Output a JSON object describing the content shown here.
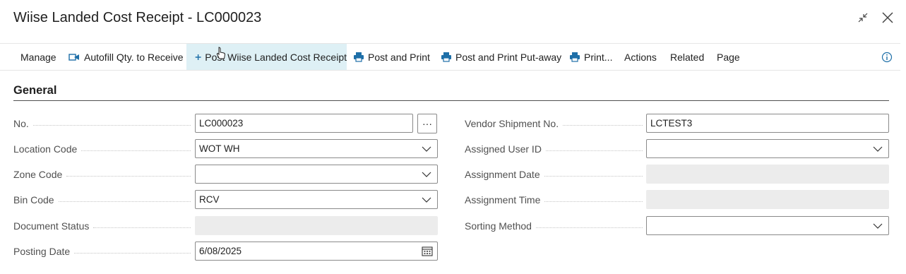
{
  "window": {
    "title": "Wiise Landed Cost Receipt - LC000023",
    "collapse_icon": "collapse-arrows-icon",
    "close_icon": "close-icon"
  },
  "toolbar": {
    "manage": "Manage",
    "autofill": "Autofill Qty. to Receive",
    "post": "Post Wiise Landed Cost Receipt",
    "post_and_print": "Post and Print",
    "post_and_print_putaway": "Post and Print Put-away",
    "print": "Print...",
    "actions": "Actions",
    "related": "Related",
    "page": "Page",
    "info_icon": "info-icon",
    "accent_color": "#008575"
  },
  "general": {
    "title": "General",
    "left": {
      "no": {
        "label": "No.",
        "value": "LC000023"
      },
      "location_code": {
        "label": "Location Code",
        "value": "WOT WH"
      },
      "zone_code": {
        "label": "Zone Code",
        "value": ""
      },
      "bin_code": {
        "label": "Bin Code",
        "value": "RCV"
      },
      "document_status": {
        "label": "Document Status",
        "value": ""
      },
      "posting_date": {
        "label": "Posting Date",
        "value": "6/08/2025"
      }
    },
    "right": {
      "vendor_shipment_no": {
        "label": "Vendor Shipment No.",
        "value": "LCTEST3"
      },
      "assigned_user_id": {
        "label": "Assigned User ID",
        "value": ""
      },
      "assignment_date": {
        "label": "Assignment Date",
        "value": ""
      },
      "assignment_time": {
        "label": "Assignment Time",
        "value": ""
      },
      "sorting_method": {
        "label": "Sorting Method",
        "value": ""
      }
    },
    "assist_button": "···"
  }
}
